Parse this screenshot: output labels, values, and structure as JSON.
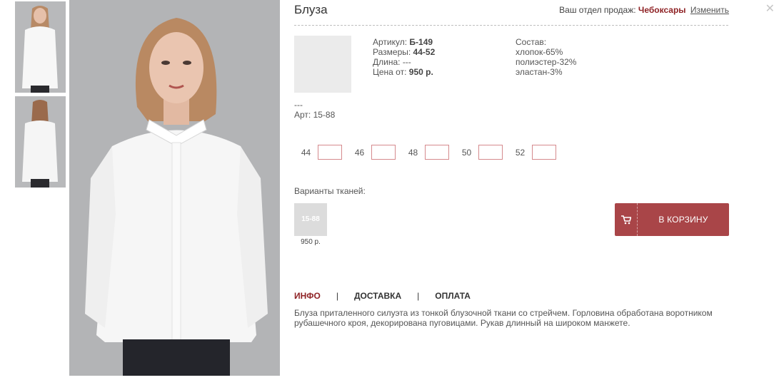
{
  "product": {
    "title": "Блуза"
  },
  "sales_dept": {
    "label": "Ваш отдел продаж:",
    "city": "Чебоксары",
    "change_link": "Изменить"
  },
  "specs": {
    "article_label": "Артикул:",
    "article": "Б-149",
    "sizes_label": "Размеры:",
    "sizes": "44-52",
    "length_label": "Длина:",
    "length": "---",
    "price_label": "Цена от:",
    "price": "950 р."
  },
  "composition": {
    "label": "Состав:",
    "items": [
      "хлопок-65%",
      "полиэстер-32%",
      "эластан-3%"
    ]
  },
  "notes": {
    "line1": "---",
    "line2": "Арт: 15-88"
  },
  "size_inputs": [
    {
      "label": "44",
      "value": ""
    },
    {
      "label": "46",
      "value": ""
    },
    {
      "label": "48",
      "value": ""
    },
    {
      "label": "50",
      "value": ""
    },
    {
      "label": "52",
      "value": ""
    }
  ],
  "fabrics": {
    "label": "Варианты тканей:",
    "items": [
      {
        "code": "15-88",
        "price": "950 р."
      }
    ]
  },
  "cart": {
    "label": "В КОРЗИНУ",
    "icon": "cart-icon"
  },
  "tabs": [
    {
      "label": "ИНФО",
      "active": true
    },
    {
      "label": "ДОСТАВКА",
      "active": false
    },
    {
      "label": "ОПЛАТА",
      "active": false
    }
  ],
  "tab_separator": "|",
  "description": "Блуза приталенного силуэта из тонкой блузочной ткани со стрейчем. Горловина обработана воротником рубашечного кроя, декорирована пуговицами. Рукав длинный на широком манжете.",
  "colors": {
    "accent": "#8f2326",
    "button": "#a94548",
    "size_border": "#d58a8d"
  }
}
